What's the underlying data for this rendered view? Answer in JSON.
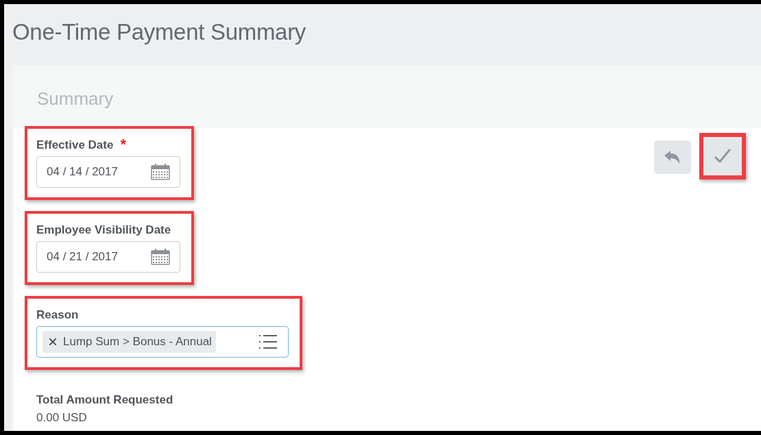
{
  "title": "One-Time Payment Summary",
  "section_title": "Summary",
  "fields": [
    {
      "kind": "date",
      "label": "Effective Date",
      "required_mark": "*",
      "value": "04 / 14 / 2017",
      "highlighted": true
    },
    {
      "kind": "date",
      "label": "Employee Visibility Date",
      "value": "04 / 21 / 2017",
      "highlighted": true
    },
    {
      "kind": "multiselect",
      "label": "Reason",
      "remove_mark": "×",
      "tokens": [
        "Lump Sum > Bonus - Annual"
      ],
      "highlighted": true
    },
    {
      "kind": "readonly",
      "label": "Total Amount Requested",
      "value": "0.00 USD",
      "highlighted": false
    }
  ],
  "buttons": [
    {
      "kind": "cancel",
      "highlighted": false
    },
    {
      "kind": "submit",
      "highlighted": true
    }
  ]
}
